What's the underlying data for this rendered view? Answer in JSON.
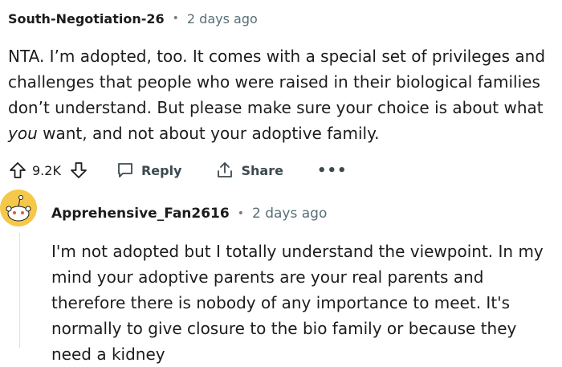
{
  "comment1": {
    "author": "South-Negotiation-26",
    "separator": "•",
    "time": "2 days ago",
    "text_before_em": "NTA. I’m adopted, too. It comes with a special set of privileges and challenges that people who were raised in their biological families don’t understand. But please make sure your choice is about what ",
    "text_em": "you",
    "text_after_em": " want, and not about your adoptive family.",
    "score": "9.2K",
    "reply_label": "Reply",
    "share_label": "Share",
    "more_label": "•••"
  },
  "comment2": {
    "author": "Apprehensive_Fan2616",
    "separator": "•",
    "time": "2 days ago",
    "text": "I'm not adopted but I totally understand the viewpoint. In my mind your adoptive parents are your real parents and therefore there is nobody of any importance to meet. It's normally to give closure to the bio family or because they need a kidney"
  },
  "icons": {
    "upvote": "upvote-arrow-icon",
    "downvote": "downvote-arrow-icon",
    "reply": "speech-bubble-icon",
    "share": "share-upload-icon",
    "more": "ellipsis-icon",
    "avatar": "snoo-avatar-icon"
  },
  "colors": {
    "avatar_bg": "#f5c84a",
    "meta_gray": "#576f76"
  }
}
